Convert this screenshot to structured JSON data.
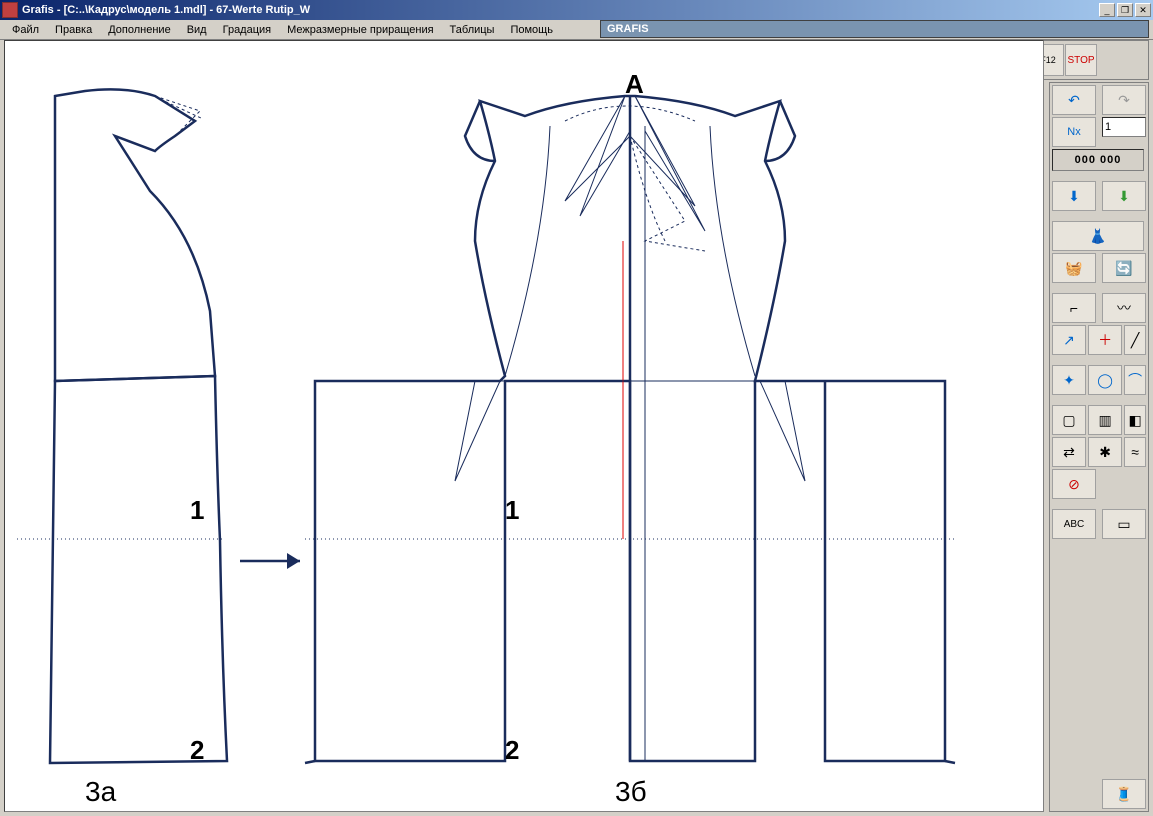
{
  "window": {
    "title": "Grafis - [C:..\\Кадрус\\модель 1.mdl] - 67-Werte Rutip_W"
  },
  "subwindow": {
    "title": "GRAFIS"
  },
  "menu": {
    "items": [
      "Файл",
      "Правка",
      "Дополнение",
      "Вид",
      "Градация",
      "Межразмерные приращения",
      "Таблицы",
      "Помощь"
    ]
  },
  "toolbar_top": {
    "icons": [
      "folder-open-icon",
      "save-icon",
      "print-icon",
      "zoom-icon",
      "f6-icon",
      "rotate-icon",
      "measure-icon",
      "ruler-icon",
      "download-icon",
      "download2-icon",
      "g-icon",
      "cut-icon",
      "f11-icon",
      "f12-icon",
      "stop-icon"
    ]
  },
  "right_panel": {
    "nx_input": "1",
    "counter": "000 000"
  },
  "canvas": {
    "labels": {
      "A": "А",
      "one_left": "1",
      "two_left": "2",
      "one_right": "1",
      "two_right": "2",
      "caption_left": "3а",
      "caption_right": "3б"
    }
  }
}
